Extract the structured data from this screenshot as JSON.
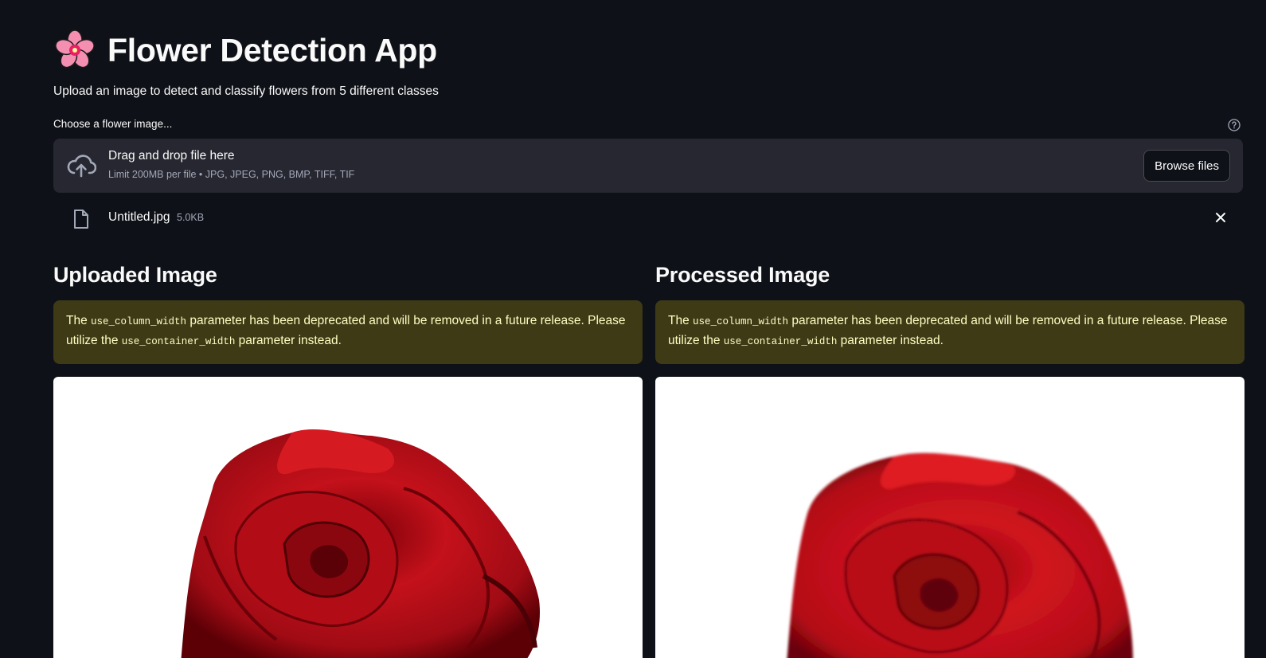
{
  "header": {
    "title": "Flower Detection App",
    "title_icon": "cherry-blossom-icon",
    "subtitle": "Upload an image to detect and classify flowers from 5 different classes"
  },
  "uploader": {
    "label": "Choose a flower image...",
    "drop_title": "Drag and drop file here",
    "drop_limit": "Limit 200MB per file • JPG, JPEG, PNG, BMP, TIFF, TIF",
    "browse_label": "Browse files",
    "file": {
      "name": "Untitled.jpg",
      "size": "5.0KB"
    }
  },
  "columns": [
    {
      "title": "Uploaded Image",
      "warning": {
        "pre": "The ",
        "code1": "use_column_width",
        "mid": " parameter has been deprecated and will be removed in a future release. Please utilize the ",
        "code2": "use_container_width",
        "post": " parameter instead."
      }
    },
    {
      "title": "Processed Image",
      "warning": {
        "pre": "The ",
        "code1": "use_column_width",
        "mid": " parameter has been deprecated and will be removed in a future release. Please utilize the ",
        "code2": "use_container_width",
        "post": " parameter instead."
      }
    }
  ],
  "colors": {
    "background": "#0e1117",
    "surface": "#262730",
    "warning_bg": "#3e3a16",
    "warning_text": "#ffffc2",
    "rose_red": "#c4111b"
  }
}
